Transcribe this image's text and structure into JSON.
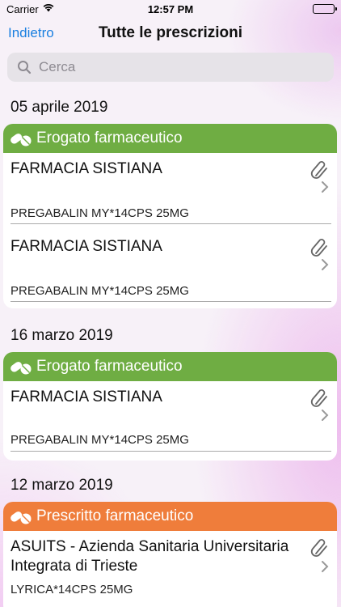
{
  "status": {
    "carrier": "Carrier",
    "time": "12:57 PM"
  },
  "nav": {
    "back": "Indietro",
    "title": "Tutte le prescrizioni"
  },
  "search": {
    "placeholder": "Cerca"
  },
  "sections": [
    {
      "date": "05 aprile 2019",
      "category": "Erogato farmaceutico",
      "color": "#6fad43",
      "items": [
        {
          "place": "FARMACIA SISTIANA",
          "drug": "PREGABALIN MY*14CPS 25MG"
        },
        {
          "place": "FARMACIA SISTIANA",
          "drug": "PREGABALIN MY*14CPS 25MG"
        }
      ]
    },
    {
      "date": "16 marzo 2019",
      "category": "Erogato farmaceutico",
      "color": "#6fad43",
      "items": [
        {
          "place": "FARMACIA SISTIANA",
          "drug": "PREGABALIN MY*14CPS 25MG"
        }
      ]
    },
    {
      "date": "12 marzo 2019",
      "category": "Prescritto farmaceutico",
      "color": "#ef7d3b",
      "items": [
        {
          "place": "ASUITS - Azienda Sanitaria Universitaria Integrata di Trieste",
          "drug": "LYRICA*14CPS 25MG"
        }
      ]
    }
  ],
  "icons": {
    "pill": "pills-icon",
    "attachment": "paperclip-icon",
    "chevron": "chevron-right-icon",
    "search": "magnifier-icon"
  }
}
